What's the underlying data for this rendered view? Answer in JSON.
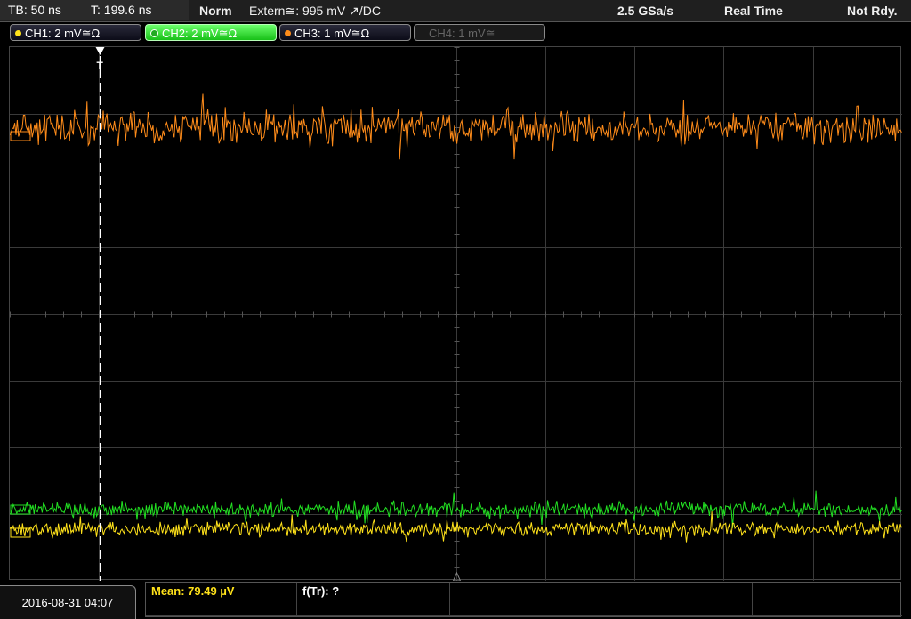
{
  "status": {
    "timebase": "TB: 50 ns",
    "trigger_time": "T: 199.6 ns",
    "mode": "Norm",
    "trigger_source": "Extern≅: 995 mV ↗/DC",
    "sample_rate": "2.5 GSa/s",
    "acq_mode": "Real Time",
    "state": "Not Rdy."
  },
  "channels": [
    {
      "label": "CH1: 2 mV≅Ω",
      "color": "#ffe21a",
      "active": false,
      "enabled": true
    },
    {
      "label": "CH2: 2 mV≅Ω",
      "color": "#22e022",
      "active": true,
      "enabled": true
    },
    {
      "label": "CH3: 1 mV≅Ω",
      "color": "#ff8c1a",
      "active": false,
      "enabled": true
    },
    {
      "label": "CH4: 1 mV≅",
      "color": "#666666",
      "active": false,
      "enabled": false
    }
  ],
  "colors": {
    "ch1": "#ffe21a",
    "ch2": "#22e022",
    "ch3": "#ff8c1a",
    "grid": "#3a3a3a",
    "background": "#000000"
  },
  "datetime": "2016-08-31 04:07",
  "measurements": {
    "mean": "Mean: 79.49 µV",
    "freq": "f(Tr): ?"
  }
}
